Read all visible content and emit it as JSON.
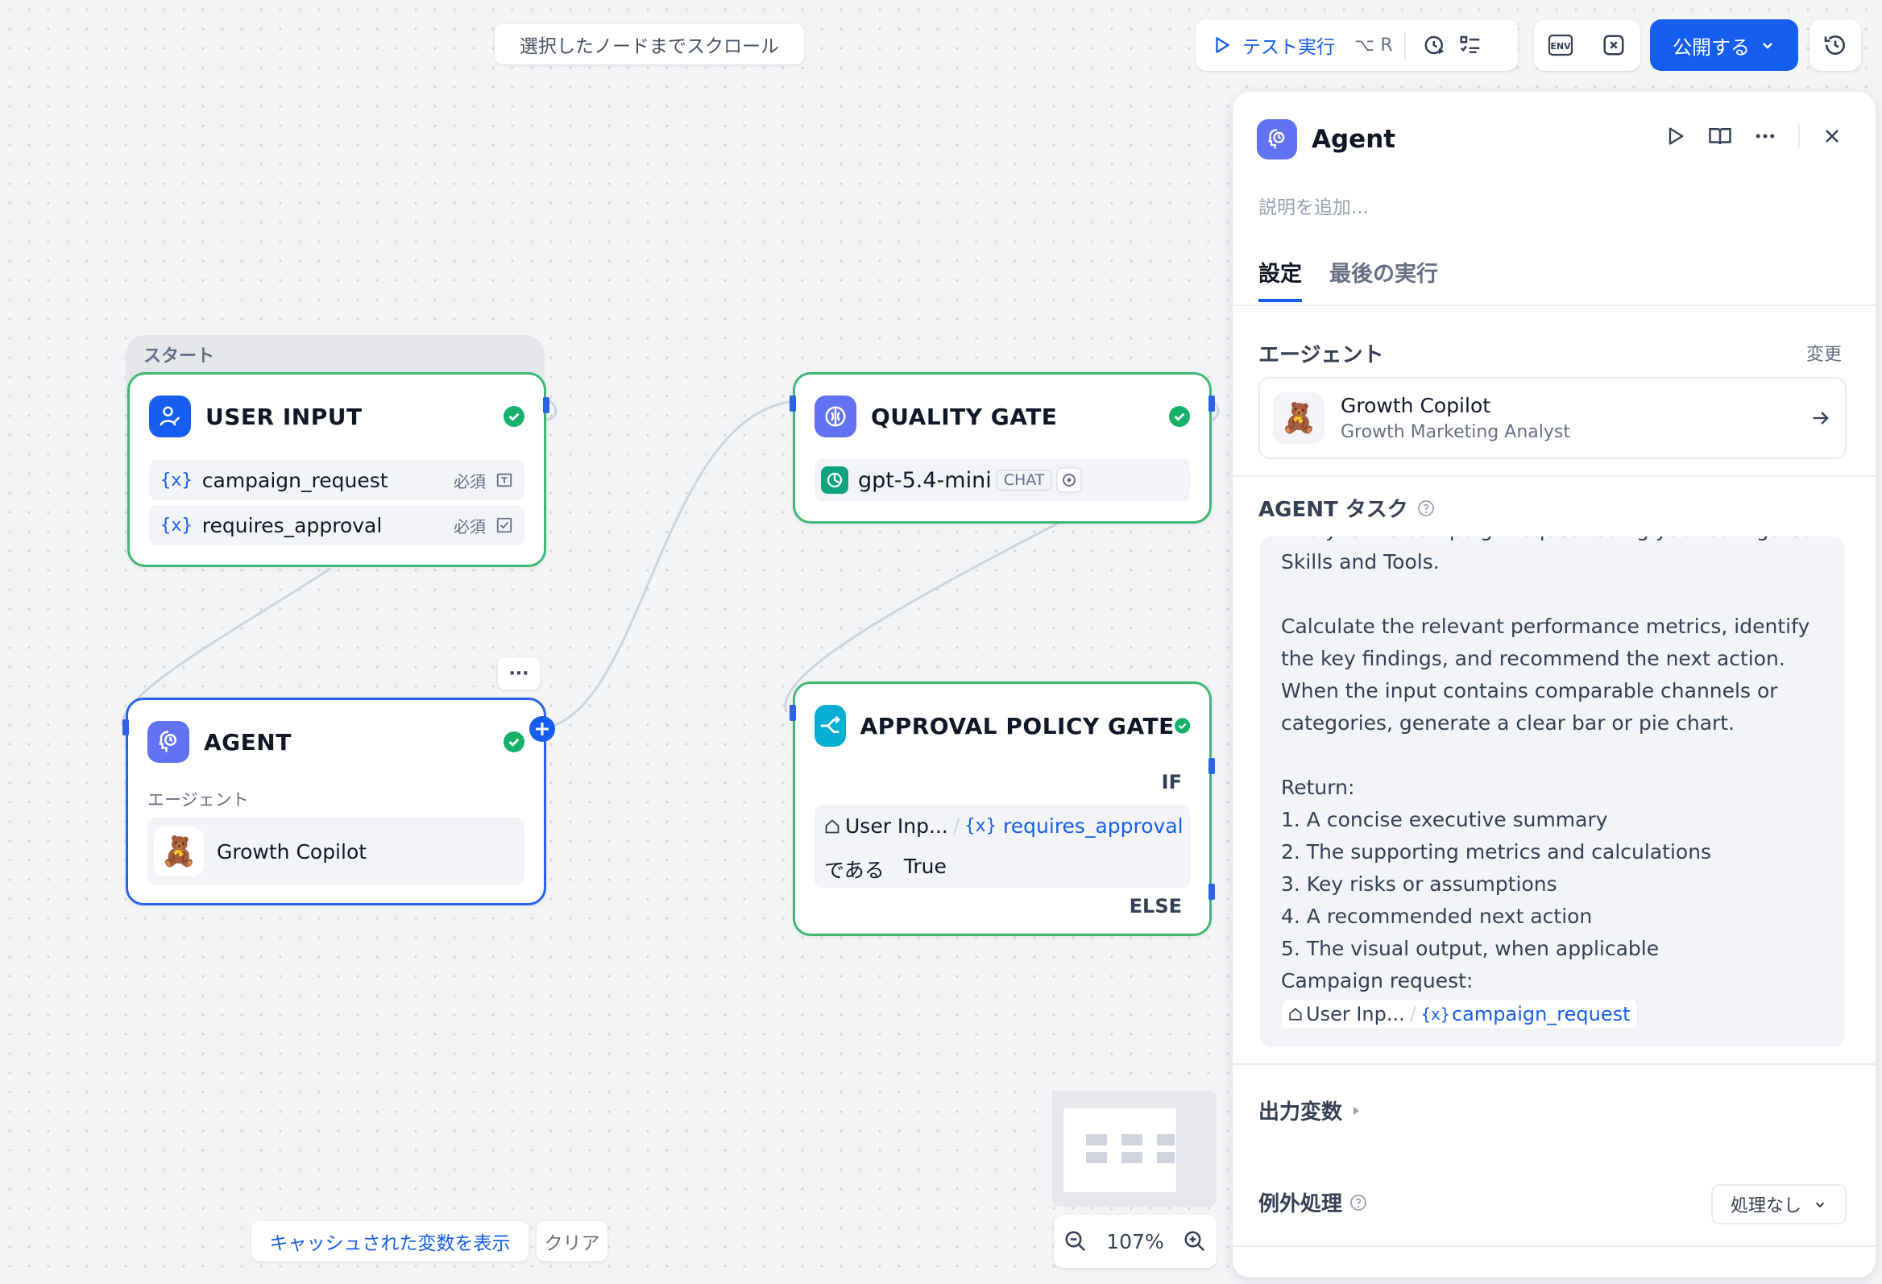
{
  "toolbar": {
    "scroll_to_selected": "選択したノードまでスクロール",
    "test_run": "テスト実行",
    "test_run_shortcut": "⌥ R",
    "env_label": "ENV",
    "publish": "公開する"
  },
  "canvas": {
    "start_label": "スタート",
    "user_input": {
      "title": "USER INPUT",
      "vars": [
        {
          "name": "campaign_request",
          "required": "必須"
        },
        {
          "name": "requires_approval",
          "required": "必須"
        }
      ]
    },
    "agent": {
      "title": "AGENT",
      "subtitle": "エージェント",
      "agent_name": "Growth Copilot",
      "avatar": "🧸"
    },
    "quality_gate": {
      "title": "QUALITY GATE",
      "model": "gpt-5.4-mini",
      "mode": "CHAT"
    },
    "approval_gate": {
      "title": "APPROVAL POLICY GATE",
      "if_label": "IF",
      "source_node": "User Inp...",
      "separator": "/",
      "variable": "requires_approval",
      "operator": "である",
      "value": "True",
      "else_label": "ELSE"
    },
    "var_symbol": "{x}",
    "more_dots": "···"
  },
  "bottom": {
    "show_cached": "キャッシュされた変数を表示",
    "clear": "クリア",
    "zoom": "107%"
  },
  "panel": {
    "title": "Agent",
    "description_placeholder": "説明を追加...",
    "tabs": [
      "設定",
      "最後の実行"
    ],
    "agent_section": "エージェント",
    "change": "変更",
    "agent_name": "Growth Copilot",
    "agent_role": "Growth Marketing Analyst",
    "avatar": "🧸",
    "task_section": "AGENT タスク",
    "task_text": "Analyze the campaign request using your configured\nSkills and Tools.\n\nCalculate the relevant performance metrics, identify the key findings, and recommend the next action. When the input contains comparable channels or categories, generate a clear bar or pie chart.\n\nReturn:\n1. A concise executive summary\n2. The supporting metrics and calculations\n3. Key risks or assumptions\n4. A recommended next action\n5. The visual output, when applicable\n",
    "task_campaign_prefix": "Campaign request:",
    "task_chip_node": "User Inp...",
    "task_chip_sep": "/",
    "task_chip_var": "campaign_request",
    "output_vars": "出力変数",
    "exception_handling": "例外処理",
    "exception_value": "処理なし"
  },
  "colors": {
    "accent": "#155eef",
    "success": "#17b26a",
    "node_border": "#3fb873",
    "selected_border": "#2a62e8"
  }
}
